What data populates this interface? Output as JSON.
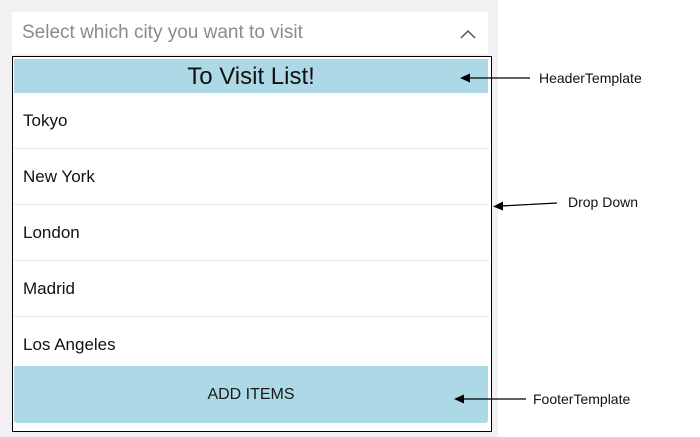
{
  "picker": {
    "placeholder": "Select which city you want to visit",
    "expanded_icon": "chevron-up-icon"
  },
  "dropdown": {
    "header_text": "To Visit List!",
    "items": [
      "Tokyo",
      "New York",
      "London",
      "Madrid",
      "Los Angeles"
    ],
    "footer_button_label": "ADD ITEMS"
  },
  "annotations": {
    "header": "HeaderTemplate",
    "dropdown": "Drop Down",
    "footer": "FooterTemplate"
  },
  "colors": {
    "template_background": "#add8e6",
    "page_background": "#f1f1f3",
    "dropdown_border": "#000000"
  }
}
